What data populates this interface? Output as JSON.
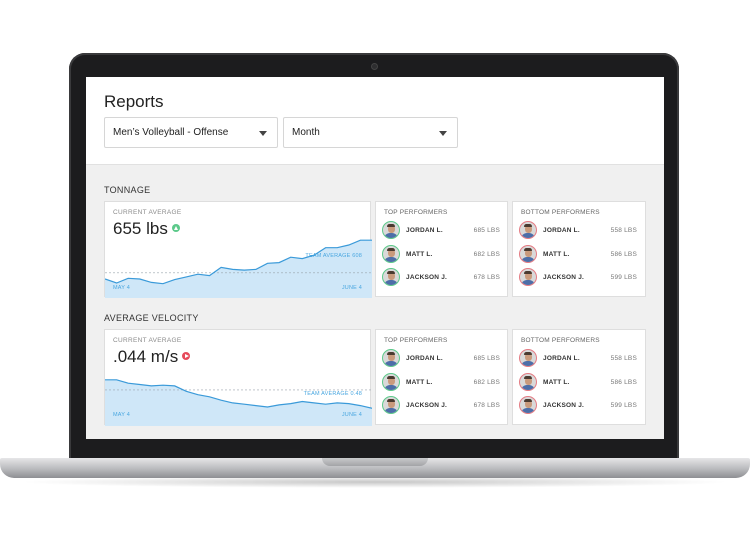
{
  "header": {
    "title": "Reports",
    "team_select": "Men’s Volleyball - Offense",
    "period_select": "Month"
  },
  "sections": [
    {
      "label": "TONNAGE",
      "current_label": "CURRENT AVERAGE",
      "current_value": "655 lbs",
      "trend": "up",
      "team_average_label": "TEAM AVERAGE 608",
      "date_start": "MAY 4",
      "date_end": "JUNE 4",
      "series": [
        28,
        22,
        29,
        28,
        23,
        21,
        27,
        31,
        35,
        33,
        45,
        42,
        41,
        42,
        51,
        52,
        60,
        58,
        63,
        74,
        74,
        78,
        85,
        85
      ],
      "team_average": 37,
      "top_title": "TOP PERFORMERS",
      "top": [
        {
          "name": "JORDAN L.",
          "value": "685 LBS"
        },
        {
          "name": "MATT L.",
          "value": "682 LBS"
        },
        {
          "name": "JACKSON J.",
          "value": "678 LBS"
        }
      ],
      "bottom_title": "BOTTOM PERFORMERS",
      "bottom": [
        {
          "name": "JORDAN L.",
          "value": "558 LBS"
        },
        {
          "name": "MATT L.",
          "value": "586 LBS"
        },
        {
          "name": "JACKSON J.",
          "value": "599 LBS"
        }
      ]
    },
    {
      "label": "AVERAGE VELOCITY",
      "current_label": "CURRENT AVERAGE",
      "current_value": ".044 m/s",
      "trend": "down",
      "team_average_label": "TEAM AVERAGE 0.48",
      "date_start": "MAY 4",
      "date_end": "JUNE 4",
      "series": [
        68,
        68,
        63,
        61,
        59,
        60,
        59,
        51,
        46,
        43,
        38,
        34,
        32,
        30,
        28,
        31,
        33,
        36,
        34,
        32,
        34,
        33,
        30,
        26
      ],
      "team_average": 53,
      "top_title": "TOP PERFORMERS",
      "top": [
        {
          "name": "JORDAN L.",
          "value": "685 LBS"
        },
        {
          "name": "MATT L.",
          "value": "682 LBS"
        },
        {
          "name": "JACKSON J.",
          "value": "678 LBS"
        }
      ],
      "bottom_title": "BOTTOM PERFORMERS",
      "bottom": [
        {
          "name": "JORDAN L.",
          "value": "558 LBS"
        },
        {
          "name": "MATT L.",
          "value": "586 LBS"
        },
        {
          "name": "JACKSON J.",
          "value": "599 LBS"
        }
      ]
    }
  ],
  "colors": {
    "line": "#3a9ad9",
    "fill": "#cfe7f8",
    "trend_up": "#5cc98a",
    "trend_down": "#e64b5b"
  }
}
